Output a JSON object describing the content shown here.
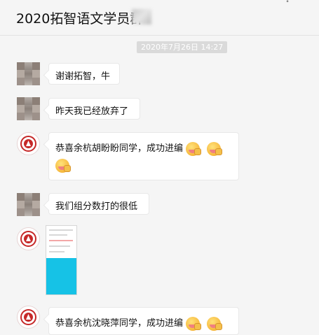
{
  "window": {
    "title": "2020拓智语文学员群"
  },
  "chat": {
    "timestamp": "2020年7月26日 14:27",
    "messages": [
      {
        "text": "谢谢拓智，牛"
      },
      {
        "text": "昨天我已经放弃了"
      },
      {
        "text": "恭喜余杭胡盼盼同学，成功进编"
      },
      {
        "text": "我们组分数打的很低"
      },
      {
        "text": "恭喜余杭沈晓萍同学，成功进编"
      }
    ]
  },
  "colors": {
    "background": "#f5f5f5",
    "bubble": "#ffffff",
    "logo_red": "#c62828",
    "image_cyan": "#16c2e6"
  },
  "icons": {
    "pin": "pin-icon",
    "emoji": "applause-emoji-icon"
  }
}
